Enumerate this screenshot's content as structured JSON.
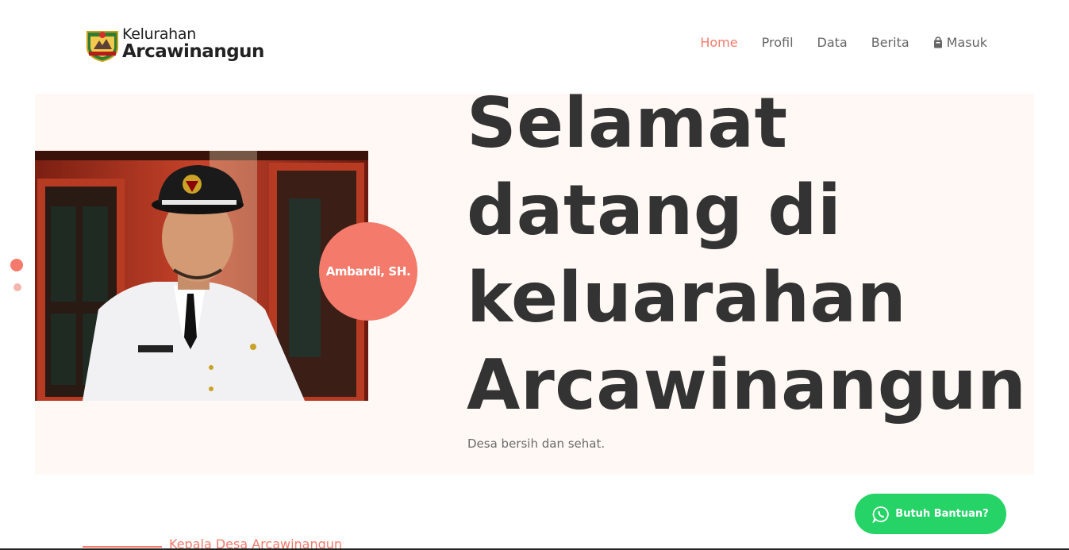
{
  "header": {
    "logo": {
      "line1": "Kelurahan",
      "line2": "Arcawinangun",
      "emblem_icon": "regency-emblem-icon"
    },
    "nav": [
      {
        "label": "Home",
        "active": true
      },
      {
        "label": "Profil",
        "active": false
      },
      {
        "label": "Data",
        "active": false
      },
      {
        "label": "Berita",
        "active": false
      },
      {
        "label": "Masuk",
        "active": false,
        "icon": "shopping-bag-icon"
      }
    ]
  },
  "hero": {
    "headline": [
      "Selamat",
      "datang di",
      "keluarahan",
      "Arcawinangun"
    ],
    "subtitle": "Desa bersih dan sehat.",
    "photo_name": "Ambardi, SH."
  },
  "section": {
    "caption": "Kepala Desa Arcawinangun"
  },
  "help_button": {
    "label": "Butuh Bantuan?",
    "icon": "whatsapp-icon"
  },
  "colors": {
    "accent": "#f47a6b",
    "hero_bg": "#fff8f5",
    "whatsapp": "#25d366",
    "text_dark": "#333333"
  }
}
